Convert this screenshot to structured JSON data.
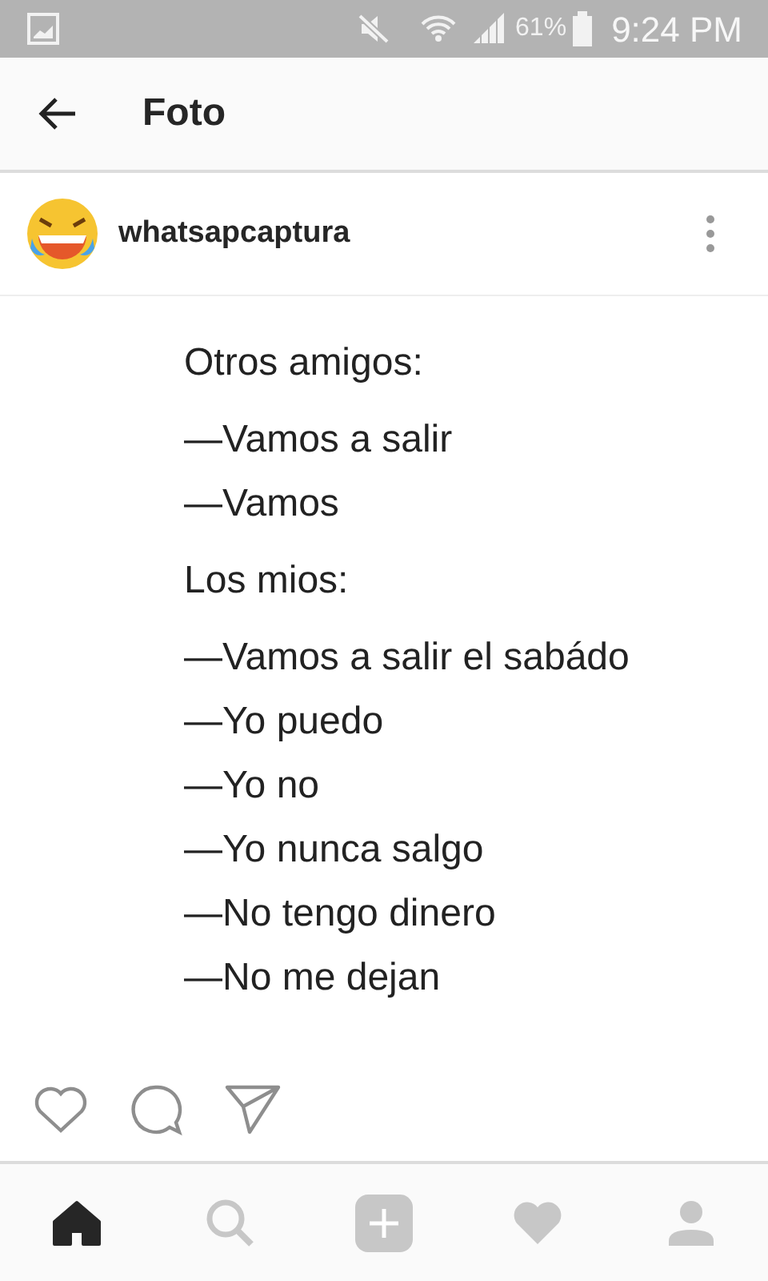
{
  "status_bar": {
    "battery": "61%",
    "time": "9:24 PM"
  },
  "app_bar": {
    "title": "Foto"
  },
  "post": {
    "username": "whatsapcaptura",
    "sections": [
      {
        "heading": "Otros amigos:",
        "lines": [
          "—Vamos a salir",
          "—Vamos"
        ]
      },
      {
        "heading": "Los mios:",
        "lines": [
          "—Vamos a salir el sabádo",
          "—Yo puedo",
          "—Yo no",
          "—Yo nunca salgo",
          "—No tengo dinero",
          "—No me dejan"
        ]
      }
    ]
  },
  "bottom_nav": [
    {
      "kind": "home",
      "selected": true
    },
    {
      "kind": "search",
      "selected": false
    },
    {
      "kind": "add",
      "selected": false
    },
    {
      "kind": "activity",
      "selected": false
    },
    {
      "kind": "profile",
      "selected": false
    }
  ]
}
